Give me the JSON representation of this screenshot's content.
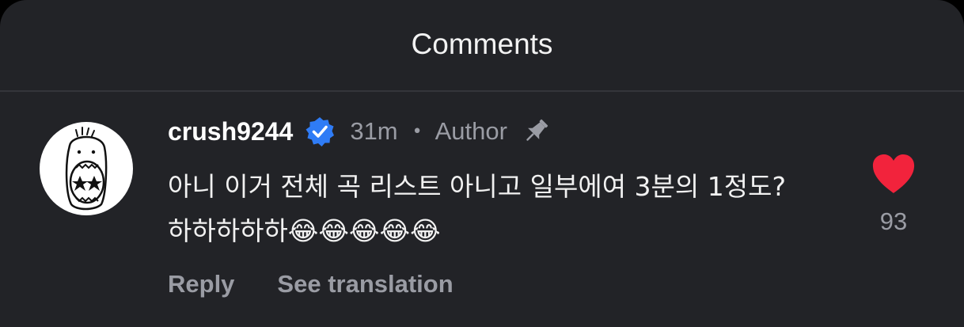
{
  "header": {
    "title": "Comments"
  },
  "comment": {
    "username": "crush9244",
    "time": "31m",
    "separator": "•",
    "author_badge": "Author",
    "text": "아니 이거 전체 곡 리스트 아니고 일부에여 3분의 1정도? 하하하하하😂😂😂😂😂",
    "actions": {
      "reply_label": "Reply",
      "translate_label": "See translation"
    },
    "likes": "93",
    "icons": {
      "verified": "verified-badge-icon",
      "pin": "pin-icon",
      "like": "heart-icon"
    }
  },
  "colors": {
    "background": "#222327",
    "primary_text": "#f1f1f1",
    "secondary_text": "#9a9ca4",
    "verified": "#2f7cf6",
    "like": "#f2233c"
  }
}
